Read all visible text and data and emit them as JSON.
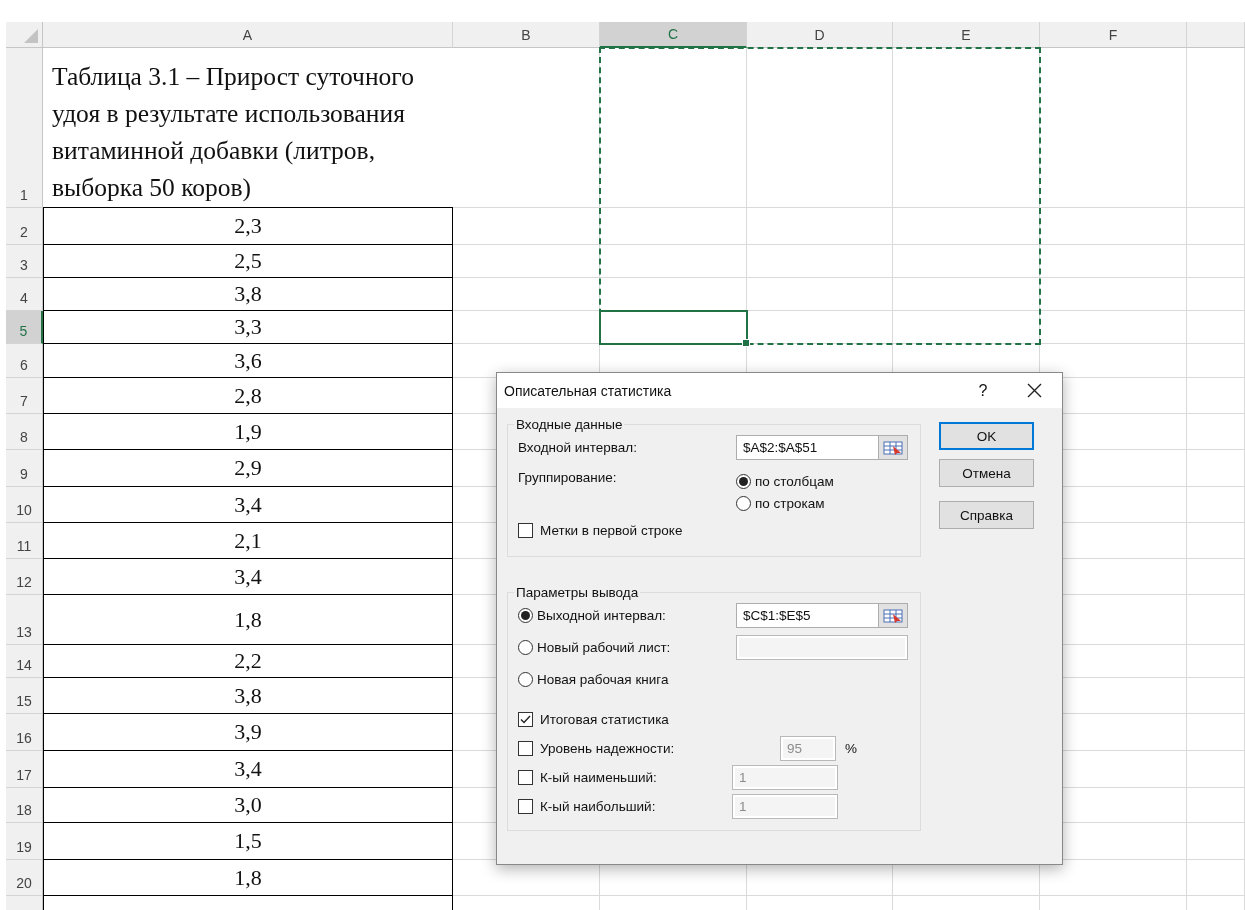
{
  "sheet": {
    "columns": [
      {
        "label": "A",
        "selected": false
      },
      {
        "label": "B",
        "selected": false
      },
      {
        "label": "C",
        "selected": true
      },
      {
        "label": "D",
        "selected": false
      },
      {
        "label": "E",
        "selected": false
      },
      {
        "label": "F",
        "selected": false
      }
    ],
    "rows": [
      {
        "number": "1",
        "value": "Таблица 3.1 – Прирост суточного удоя в результате использования витаминной добавки (литров, выборка 50 коров)",
        "kind": "heading",
        "selected": false
      },
      {
        "number": "2",
        "value": "2,3",
        "kind": "value",
        "selected": false
      },
      {
        "number": "3",
        "value": "2,5",
        "kind": "value",
        "selected": false
      },
      {
        "number": "4",
        "value": "3,8",
        "kind": "value",
        "selected": false
      },
      {
        "number": "5",
        "value": "3,3",
        "kind": "value",
        "selected": true
      },
      {
        "number": "6",
        "value": "3,6",
        "kind": "value",
        "selected": false
      },
      {
        "number": "7",
        "value": "2,8",
        "kind": "value",
        "selected": false
      },
      {
        "number": "8",
        "value": "1,9",
        "kind": "value",
        "selected": false
      },
      {
        "number": "9",
        "value": "2,9",
        "kind": "value",
        "selected": false
      },
      {
        "number": "10",
        "value": "3,4",
        "kind": "value",
        "selected": false
      },
      {
        "number": "11",
        "value": "2,1",
        "kind": "value",
        "selected": false
      },
      {
        "number": "12",
        "value": "3,4",
        "kind": "value",
        "selected": false
      },
      {
        "number": "13",
        "value": "1,8",
        "kind": "value",
        "selected": false
      },
      {
        "number": "14",
        "value": "2,2",
        "kind": "value",
        "selected": false
      },
      {
        "number": "15",
        "value": "3,8",
        "kind": "value",
        "selected": false
      },
      {
        "number": "16",
        "value": "3,9",
        "kind": "value",
        "selected": false
      },
      {
        "number": "17",
        "value": "3,4",
        "kind": "value",
        "selected": false
      },
      {
        "number": "18",
        "value": "3,0",
        "kind": "value",
        "selected": false
      },
      {
        "number": "19",
        "value": "1,5",
        "kind": "value",
        "selected": false
      },
      {
        "number": "20",
        "value": "1,8",
        "kind": "value",
        "selected": false
      }
    ]
  },
  "dialog": {
    "title": "Описательная статистика",
    "help": "?",
    "input_group": {
      "legend": "Входные данные",
      "input_range": {
        "label": "Входной интервал:",
        "value": "$A$2:$A$51"
      },
      "grouping_label": "Группирование:",
      "grouping": [
        {
          "label": "по столбцам",
          "selected": true
        },
        {
          "label": "по строкам",
          "selected": false
        }
      ],
      "labels_first_row": {
        "label": "Метки в первой строке",
        "checked": false
      }
    },
    "output_group": {
      "legend": "Параметры вывода",
      "destinations": [
        {
          "label": "Выходной интервал:",
          "selected": true,
          "value": "$C$1:$E$5",
          "kind": "range"
        },
        {
          "label": "Новый рабочий лист:",
          "selected": false,
          "kind": "text",
          "disabled": true
        },
        {
          "label": "Новая рабочая книга",
          "selected": false,
          "kind": "plain"
        }
      ],
      "options": [
        {
          "label": "Итоговая статистика",
          "checked": true,
          "kind": "plain"
        },
        {
          "label": "Уровень надежности:",
          "checked": false,
          "kind": "percent",
          "value": "95",
          "disabled": true,
          "suffix": "%"
        },
        {
          "label": "К-ый наименьший:",
          "checked": false,
          "kind": "number",
          "value": "1",
          "disabled": true
        },
        {
          "label": "К-ый наибольший:",
          "checked": false,
          "kind": "number",
          "value": "1",
          "disabled": true
        }
      ]
    },
    "buttons": [
      {
        "label": "OK",
        "default": true
      },
      {
        "label": "Отмена",
        "default": false
      },
      {
        "label": "Справка",
        "default": false
      }
    ]
  }
}
